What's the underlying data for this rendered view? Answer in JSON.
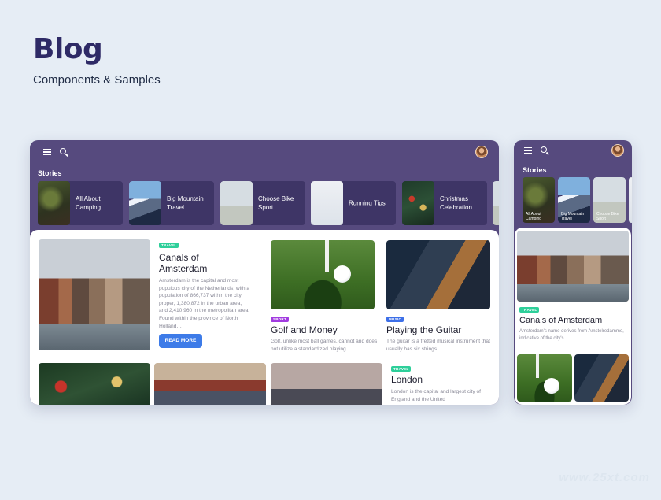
{
  "header": {
    "title": "Blog",
    "subtitle": "Components & Samples"
  },
  "icons": {
    "menu": "menu-icon",
    "search": "search-icon",
    "avatar": "avatar"
  },
  "colors": {
    "frame": "#564a7e",
    "accent_button": "#3d7be8",
    "badge_travel": "#2ecf9a",
    "badge_sport": "#a23ce0",
    "badge_music": "#3d6fe8"
  },
  "desktop": {
    "stories_label": "Stories",
    "stories": [
      {
        "label": "All About Camping"
      },
      {
        "label": "Big Mountain Travel"
      },
      {
        "label": "Choose Bike Sport"
      },
      {
        "label": "Running Tips"
      },
      {
        "label": "Christmas Celebration"
      }
    ],
    "featured": {
      "badge": "TRAVEL",
      "title": "Canals of Amsterdam",
      "text": "Amsterdam is the capital and most populous city of the Netherlands; with a population of 866,737 within the city proper, 1,380,872 in the urban area, and 2,410,960 in the metropolitan area. Found within the province of North Holland…",
      "button": "READ MORE"
    },
    "cards": [
      {
        "badge": "SPORT",
        "title": "Golf and Money",
        "text": "Golf, unlike most ball games, cannot and does not utilize a standardized playing…"
      },
      {
        "badge": "MUSIC",
        "title": "Playing the Guitar",
        "text": "The guitar is a fretted musical instrument that usually has six strings…"
      }
    ],
    "london": {
      "badge": "TRAVEL",
      "title": "London",
      "text": "London is the capital and largest city of England and the United"
    }
  },
  "mobile": {
    "stories_label": "Stories",
    "stories": [
      {
        "label": "All About Camping"
      },
      {
        "label": "Big Mountain Travel"
      },
      {
        "label": "Choose Bike Sport"
      }
    ],
    "featured": {
      "badge": "TRAVEL",
      "title": "Canals of Amsterdam",
      "text": "Amsterdam's name derives from Amstelredamme, indicative of the city's…"
    }
  },
  "watermark": "www.25xt.com"
}
